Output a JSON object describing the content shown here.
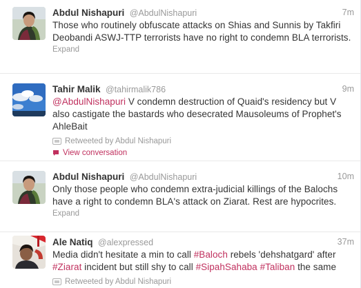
{
  "tweets": [
    {
      "name": "Abdul Nishapuri",
      "handle": "@AbdulNishapuri",
      "time": "7m",
      "text_parts": [
        "Those who routinely obfuscate attacks on Shias and Sunnis by Takfiri Deobandi ASWJ-TTP terrorists have no right to condemn BLA terrorists."
      ],
      "footer": "Expand"
    },
    {
      "name": "Tahir Malik",
      "handle": "@tahirmalik786",
      "time": "9m",
      "mention": "@AbdulNishapuri",
      "text_rest": " V condemn destruction of Quaid's residency but V also castigate the bastards who desecrated Mausoleums of Prophet's AhleBait",
      "retweeted_by": "Retweeted by Abdul Nishapuri",
      "view_conversation": "View conversation"
    },
    {
      "name": "Abdul Nishapuri",
      "handle": "@AbdulNishapuri",
      "time": "10m",
      "text": "Only those people who condemn extra-judicial killings of the Balochs have a right to condemn BLA's attack on Ziarat. Rest are hypocrites.",
      "footer": "Expand"
    },
    {
      "name": "Ale Natiq",
      "handle": "@alexpressed",
      "time": "37m",
      "seg1": "Media didn't hesitate a min to call ",
      "tag1": "#Baloch",
      "seg2": " rebels 'dehshatgard' after ",
      "tag2": "#Ziarat",
      "seg3": " incident but still shy to call ",
      "tag3": "#SipahSahaba",
      "seg4": " ",
      "tag4": "#Taliban",
      "seg5": " the same",
      "retweeted_by": "Retweeted by Abdul Nishapuri"
    }
  ],
  "colors": {
    "link": "#c0305e",
    "muted": "#999999",
    "text": "#333333"
  },
  "icons": {
    "retweet": "retweet-icon",
    "conversation": "conversation-icon"
  }
}
